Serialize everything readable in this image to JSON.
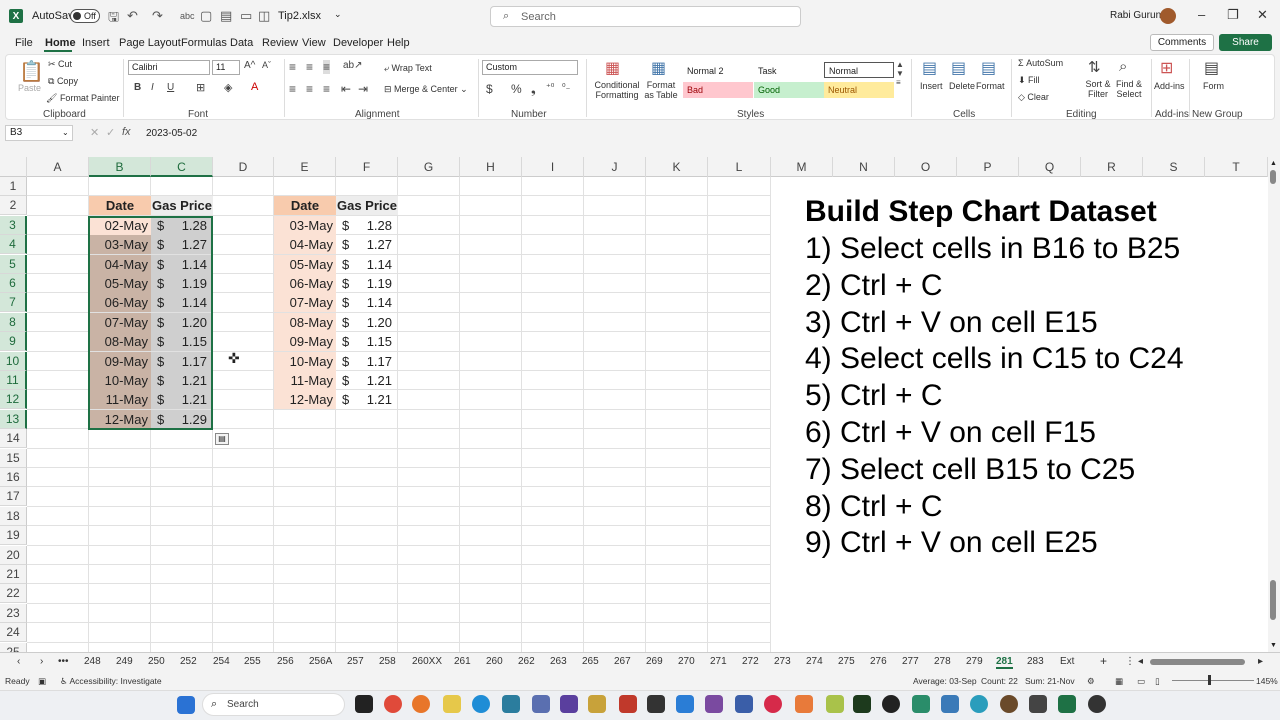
{
  "titlebar": {
    "autosave_label": "AutoSave",
    "autosave_state": "Off",
    "filename": "Tip2.xlsx",
    "search_placeholder": "Search",
    "user_name": "Rabi Gurung"
  },
  "menu": {
    "tabs": [
      "File",
      "Home",
      "Insert",
      "Page Layout",
      "Formulas",
      "Data",
      "Review",
      "View",
      "Developer",
      "Help"
    ],
    "comments": "Comments",
    "share": "Share"
  },
  "ribbon": {
    "clipboard": {
      "label": "Clipboard",
      "paste": "Paste",
      "cut": "Cut",
      "copy": "Copy",
      "format_painter": "Format Painter"
    },
    "font": {
      "label": "Font",
      "name": "Calibri",
      "size": "11"
    },
    "alignment": {
      "label": "Alignment",
      "wrap": "Wrap Text",
      "merge": "Merge & Center"
    },
    "number": {
      "label": "Number",
      "format": "Custom"
    },
    "styles": {
      "label": "Styles",
      "cond": "Conditional Formatting",
      "format_as_table": "Format as Table",
      "normal2": "Normal 2",
      "task": "Task",
      "normal": "Normal",
      "bad": "Bad",
      "good": "Good",
      "neutral": "Neutral"
    },
    "cells": {
      "label": "Cells",
      "insert": "Insert",
      "delete": "Delete",
      "format": "Format"
    },
    "editing": {
      "label": "Editing",
      "autosum": "AutoSum",
      "fill": "Fill",
      "clear": "Clear",
      "sort": "Sort & Filter",
      "find": "Find & Select"
    },
    "addins": {
      "label": "Add-ins",
      "btn": "Add-ins"
    },
    "newgroup": {
      "label": "New Group",
      "btn": "Form"
    }
  },
  "formula_bar": {
    "name_box": "B3",
    "fx": "fx",
    "content": "2023-05-02"
  },
  "columns": [
    "A",
    "B",
    "C",
    "D",
    "E",
    "F",
    "G",
    "H",
    "I",
    "J",
    "K",
    "L",
    "M",
    "N",
    "O",
    "P",
    "Q",
    "R",
    "S",
    "T"
  ],
  "rows": [
    "1",
    "2",
    "3",
    "4",
    "5",
    "6",
    "7",
    "8",
    "9",
    "10",
    "11",
    "12",
    "13",
    "14",
    "15",
    "16",
    "17",
    "18",
    "19",
    "20",
    "21",
    "22",
    "23",
    "24",
    "25"
  ],
  "table1": {
    "headers": [
      "Date",
      "Gas Price"
    ],
    "rows": [
      {
        "date": "02-May",
        "price": "1.28"
      },
      {
        "date": "03-May",
        "price": "1.27"
      },
      {
        "date": "04-May",
        "price": "1.14"
      },
      {
        "date": "05-May",
        "price": "1.19"
      },
      {
        "date": "06-May",
        "price": "1.14"
      },
      {
        "date": "07-May",
        "price": "1.20"
      },
      {
        "date": "08-May",
        "price": "1.15"
      },
      {
        "date": "09-May",
        "price": "1.17"
      },
      {
        "date": "10-May",
        "price": "1.21"
      },
      {
        "date": "11-May",
        "price": "1.21"
      },
      {
        "date": "12-May",
        "price": "1.29"
      }
    ]
  },
  "table2": {
    "headers": [
      "Date",
      "Gas Price"
    ],
    "rows": [
      {
        "date": "03-May",
        "price": "1.28"
      },
      {
        "date": "04-May",
        "price": "1.27"
      },
      {
        "date": "05-May",
        "price": "1.14"
      },
      {
        "date": "06-May",
        "price": "1.19"
      },
      {
        "date": "07-May",
        "price": "1.14"
      },
      {
        "date": "08-May",
        "price": "1.20"
      },
      {
        "date": "09-May",
        "price": "1.15"
      },
      {
        "date": "10-May",
        "price": "1.17"
      },
      {
        "date": "11-May",
        "price": "1.21"
      },
      {
        "date": "12-May",
        "price": "1.21"
      }
    ]
  },
  "currency_symbol": "$",
  "instructions": {
    "title": "Build Step Chart Dataset",
    "steps": [
      "1) Select cells in B16 to B25",
      "2) Ctrl + C",
      "3) Ctrl + V on cell E15",
      "4) Select cells in C15 to C24",
      "5) Ctrl + C",
      "6) Ctrl + V on cell F15",
      "7) Select cell B15 to C25",
      "8) Ctrl + C",
      "9) Ctrl + V on cell E25"
    ]
  },
  "sheet_tabs": [
    "248",
    "249",
    "250",
    "252",
    "254",
    "255",
    "256",
    "256A",
    "257",
    "258",
    "260XX",
    "261",
    "260",
    "262",
    "263",
    "265",
    "267",
    "269",
    "270",
    "271",
    "272",
    "273",
    "274",
    "275",
    "276",
    "277",
    "278",
    "279",
    "281",
    "283",
    "Ext"
  ],
  "active_sheet": "281",
  "statusbar": {
    "ready": "Ready",
    "accessibility": "Accessibility: Investigate",
    "average": "Average: 03-Sep",
    "count": "Count: 22",
    "sum": "Sum: 21-Nov",
    "zoom": "145%"
  },
  "taskbar": {
    "search": "Search"
  },
  "colors": {
    "accent": "#1e7145",
    "header_fill": "#f8cbad",
    "date_fill": "#fbe2d5"
  }
}
